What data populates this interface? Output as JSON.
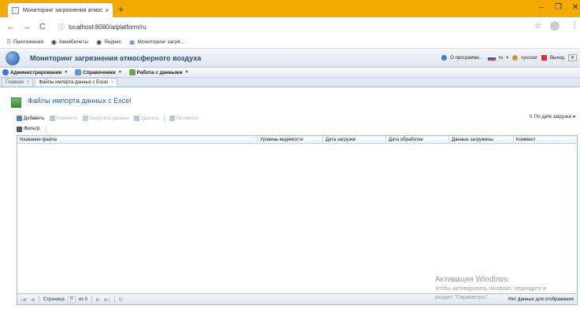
{
  "browser": {
    "tab_title": "Мониторинг загрязнения атмос",
    "tab_close": "×",
    "new_tab": "+",
    "url_info_icon": "ⓘ",
    "url": "localhost:8080/a/platform/ru",
    "bookmarks": [
      {
        "icon": "apps-icon",
        "label": "Приложения"
      },
      {
        "icon": "globe-icon",
        "label": "Авиабилеты"
      },
      {
        "icon": "globe-icon",
        "label": "Яндекс"
      },
      {
        "icon": "page-icon",
        "label": "Мониторинг загря..."
      }
    ]
  },
  "app": {
    "title": "Мониторинг загрязнения атмосферного воздуха",
    "about": "О программе...",
    "lang": "ru",
    "user": "sysuser",
    "logout": "Выход"
  },
  "menu": [
    {
      "label": "Администрирование",
      "color": "#3a7bd5"
    },
    {
      "label": "Справочники",
      "color": "#5b9bd5"
    },
    {
      "label": "Работа с данными",
      "color": "#6aa84f"
    }
  ],
  "tabs": [
    {
      "label": "Главная"
    },
    {
      "label": "Файлы импорта данных с Excel"
    }
  ],
  "panel": {
    "title": "Файлы импорта данных с Excel"
  },
  "toolbar": {
    "add": "Добавить",
    "edit": "Изменить",
    "load": "Загрузить данные",
    "delete": "Удалить",
    "view": "Просмотр",
    "sort": "По дате загрузки",
    "filter": "Фильтр"
  },
  "grid": {
    "columns": [
      "Название файла",
      "Уровень видимости",
      "Дата загрузки",
      "Дата обработки",
      "Данные загружены",
      "Коммент"
    ],
    "rows": []
  },
  "pager": {
    "page_label": "Страница",
    "page_value": "0",
    "of_label": "из 0",
    "status": "Нет данных для отображения"
  },
  "watermark": {
    "line1": "Активация Windows",
    "line2": "Чтобы активировать Windows, перейдите в",
    "line3": "раздел \"Параметры\"."
  }
}
